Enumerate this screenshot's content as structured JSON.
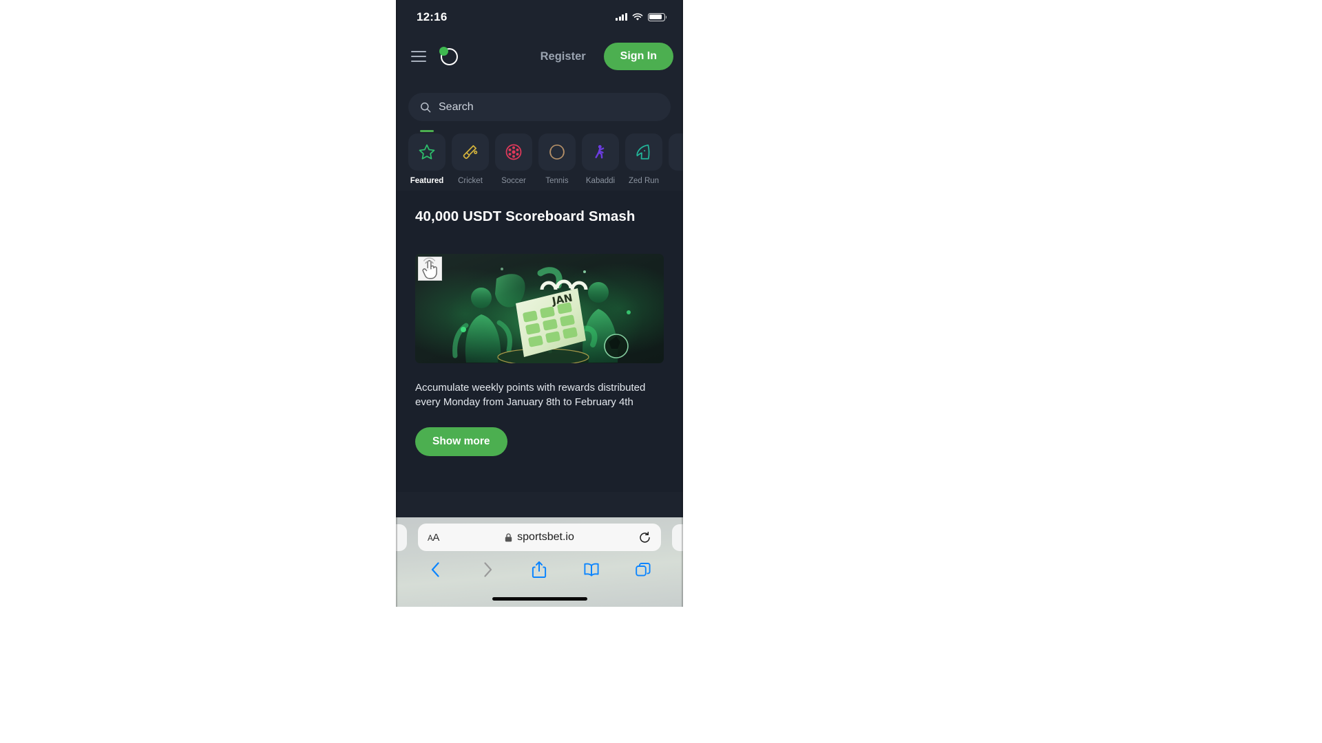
{
  "status_bar": {
    "time": "12:16",
    "signal_icon": "cellular-signal-icon",
    "wifi_icon": "wifi-icon",
    "battery_icon": "battery-icon"
  },
  "header": {
    "menu_icon": "hamburger-menu-icon",
    "logo_icon": "sportsbet-logo-icon",
    "register_label": "Register",
    "signin_label": "Sign In",
    "accent_color": "#4caf50",
    "background_color": "#1d232e"
  },
  "search": {
    "placeholder": "Search",
    "icon": "search-icon"
  },
  "categories": {
    "items": [
      {
        "label": "Featured",
        "icon": "star-icon",
        "color": "#2ebd6b",
        "active": true
      },
      {
        "label": "Cricket",
        "icon": "cricket-bat-icon",
        "color": "#d4b33c",
        "active": false
      },
      {
        "label": "Soccer",
        "icon": "soccer-ball-icon",
        "color": "#e0395a",
        "active": false
      },
      {
        "label": "Tennis",
        "icon": "tennis-ball-icon",
        "color": "#b59068",
        "active": false
      },
      {
        "label": "Kabaddi",
        "icon": "kabaddi-player-icon",
        "color": "#6c3ce0",
        "active": false
      },
      {
        "label": "Zed Run",
        "icon": "horse-head-icon",
        "color": "#22b69a",
        "active": false
      },
      {
        "label": "",
        "icon": "",
        "color": "#8b939f",
        "active": false
      }
    ]
  },
  "promo": {
    "title": "40,000 USDT Scoreboard Smash",
    "description": "Accumulate weekly points with rewards distributed every Monday from January 8th to February 4th",
    "show_more_label": "Show more",
    "banner": {
      "alt": "Two green-lit soccer players beside a large 3D JAN calendar",
      "calendar_month": "JAN"
    }
  },
  "cursor": {
    "icon": "tap-pointer-cursor-icon"
  },
  "browser": {
    "text_size_label_small": "A",
    "text_size_label_large": "A",
    "lock_icon": "lock-icon",
    "url": "sportsbet.io",
    "reload_icon": "reload-icon",
    "toolbar": [
      {
        "name": "back-button",
        "icon": "chevron-left-icon",
        "enabled": true
      },
      {
        "name": "forward-button",
        "icon": "chevron-right-icon",
        "enabled": false
      },
      {
        "name": "share-button",
        "icon": "share-icon",
        "enabled": true
      },
      {
        "name": "bookmarks-button",
        "icon": "book-icon",
        "enabled": true
      },
      {
        "name": "tabs-button",
        "icon": "tabs-icon",
        "enabled": true
      }
    ]
  }
}
